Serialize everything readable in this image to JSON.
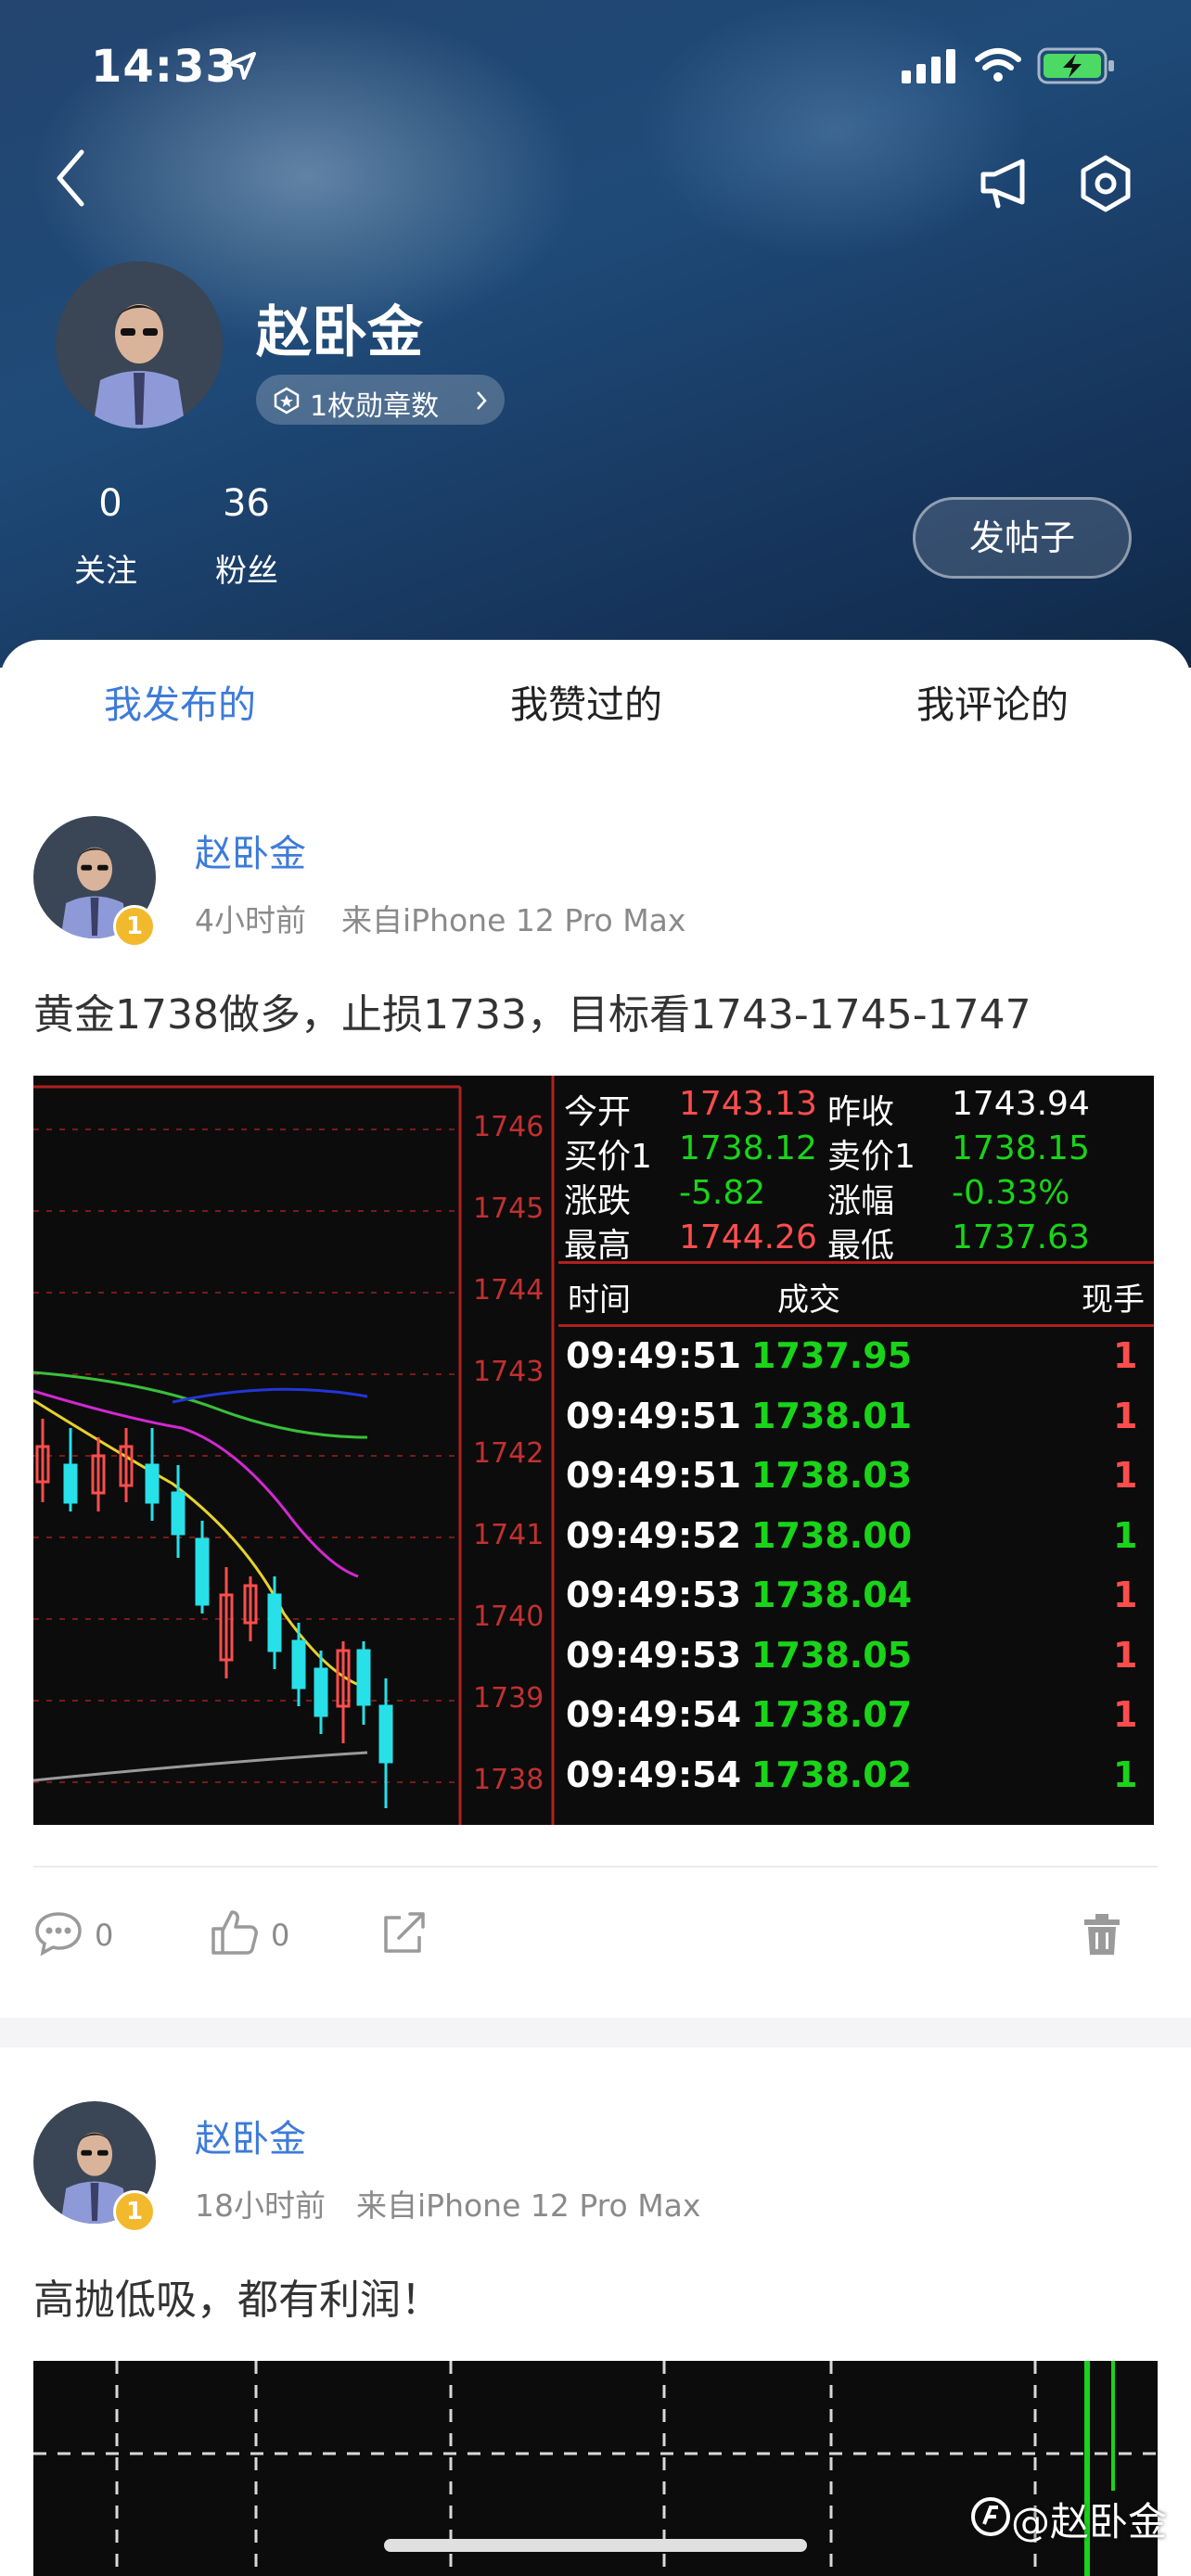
{
  "status_bar": {
    "time": "14:33",
    "icons": [
      "location-arrow-icon",
      "signal-icon",
      "wifi-icon",
      "battery-charging-icon"
    ]
  },
  "nav": {
    "back_icon": "chevron-left-icon",
    "announcement_icon": "megaphone-icon",
    "settings_icon": "settings-hexagon-icon"
  },
  "profile": {
    "name": "赵卧金",
    "medal_label": "1枚勋章数",
    "following_count": "0",
    "following_label": "关注",
    "followers_count": "36",
    "followers_label": "粉丝",
    "post_button": "发帖子"
  },
  "tabs": [
    {
      "label": "我发布的",
      "active": true
    },
    {
      "label": "我赞过的",
      "active": false
    },
    {
      "label": "我评论的",
      "active": false
    }
  ],
  "posts": [
    {
      "author": "赵卧金",
      "level": "1",
      "time": "4小时前",
      "source": "来自iPhone 12 Pro Max",
      "content": "黄金1738做多，止损1733，目标看1743-1745-1747",
      "comments": "0",
      "likes": "0"
    },
    {
      "author": "赵卧金",
      "level": "1",
      "time": "18小时前",
      "source": "来自iPhone 12 Pro Max",
      "content": "高抛低吸，都有利润！"
    }
  ],
  "chart_image": {
    "price_axis": [
      "1746",
      "1745",
      "1744",
      "1743",
      "1742",
      "1741",
      "1740",
      "1739",
      "1738"
    ],
    "quote": [
      {
        "label": "今开",
        "value": "1743.13",
        "label2": "昨收",
        "value2": "1743.94"
      },
      {
        "label": "买价1",
        "value": "1738.12",
        "label2": "卖价1",
        "value2": "1738.15"
      },
      {
        "label": "涨跌",
        "value": "-5.82",
        "label2": "涨幅",
        "value2": "-0.33%"
      },
      {
        "label": "最高",
        "value": "1744.26",
        "label2": "最低",
        "value2": "1737.63"
      }
    ],
    "trade_headers": {
      "time": "时间",
      "price": "成交",
      "volume": "现手"
    },
    "trades": [
      {
        "time": "09:49:51",
        "price": "1737.95"
      },
      {
        "time": "09:49:51",
        "price": "1738.01"
      },
      {
        "time": "09:49:51",
        "price": "1738.03"
      },
      {
        "time": "09:49:52",
        "price": "1738.00"
      },
      {
        "time": "09:49:53",
        "price": "1738.04"
      },
      {
        "time": "09:49:53",
        "price": "1738.05"
      },
      {
        "time": "09:49:54",
        "price": "1738.07"
      },
      {
        "time": "09:49:54",
        "price": "1738.02"
      }
    ],
    "trade_volume_marks": [
      "1",
      "1",
      "1",
      "1",
      "1",
      "1",
      "1",
      "1"
    ]
  },
  "watermark": "@赵卧金",
  "colors": {
    "accent": "#3d7bd9",
    "up": "#ff4d4d",
    "down": "#27e0e8",
    "green": "#19d419",
    "badge": "#f2b92c"
  }
}
